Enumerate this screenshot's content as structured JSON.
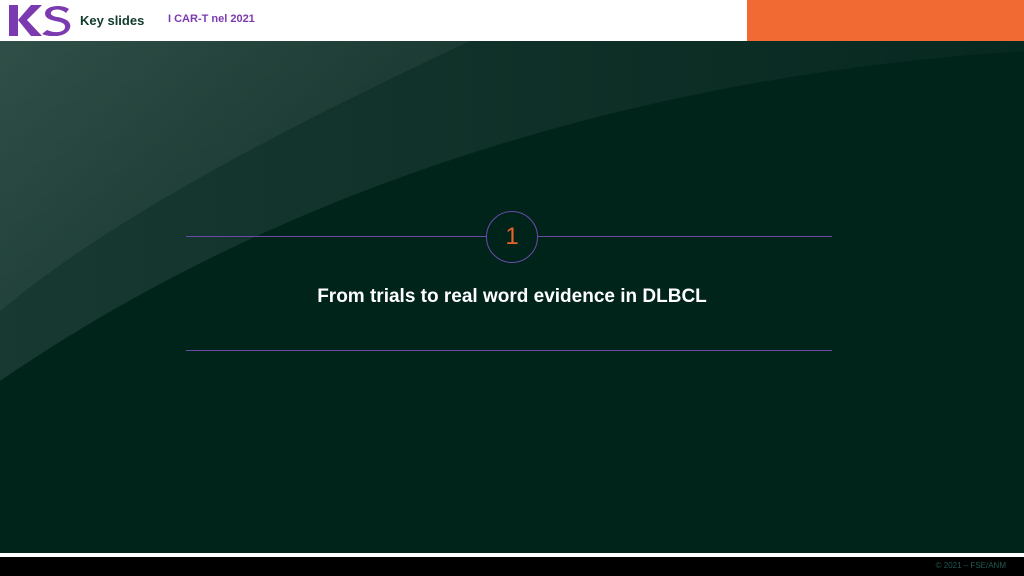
{
  "header": {
    "brand_label": "Key slides",
    "topic_label": "I CAR-T nel 2021",
    "logo_text": "KS"
  },
  "section": {
    "number": "1",
    "title": "From trials to real word evidence in DLBCL"
  },
  "footer": {
    "copyright": "© 2021 – FSE/ANM"
  },
  "colors": {
    "background": "#00241a",
    "accent_orange": "#f26a33",
    "accent_purple": "#7c3ab0",
    "rule_purple": "#6a4aa8"
  }
}
